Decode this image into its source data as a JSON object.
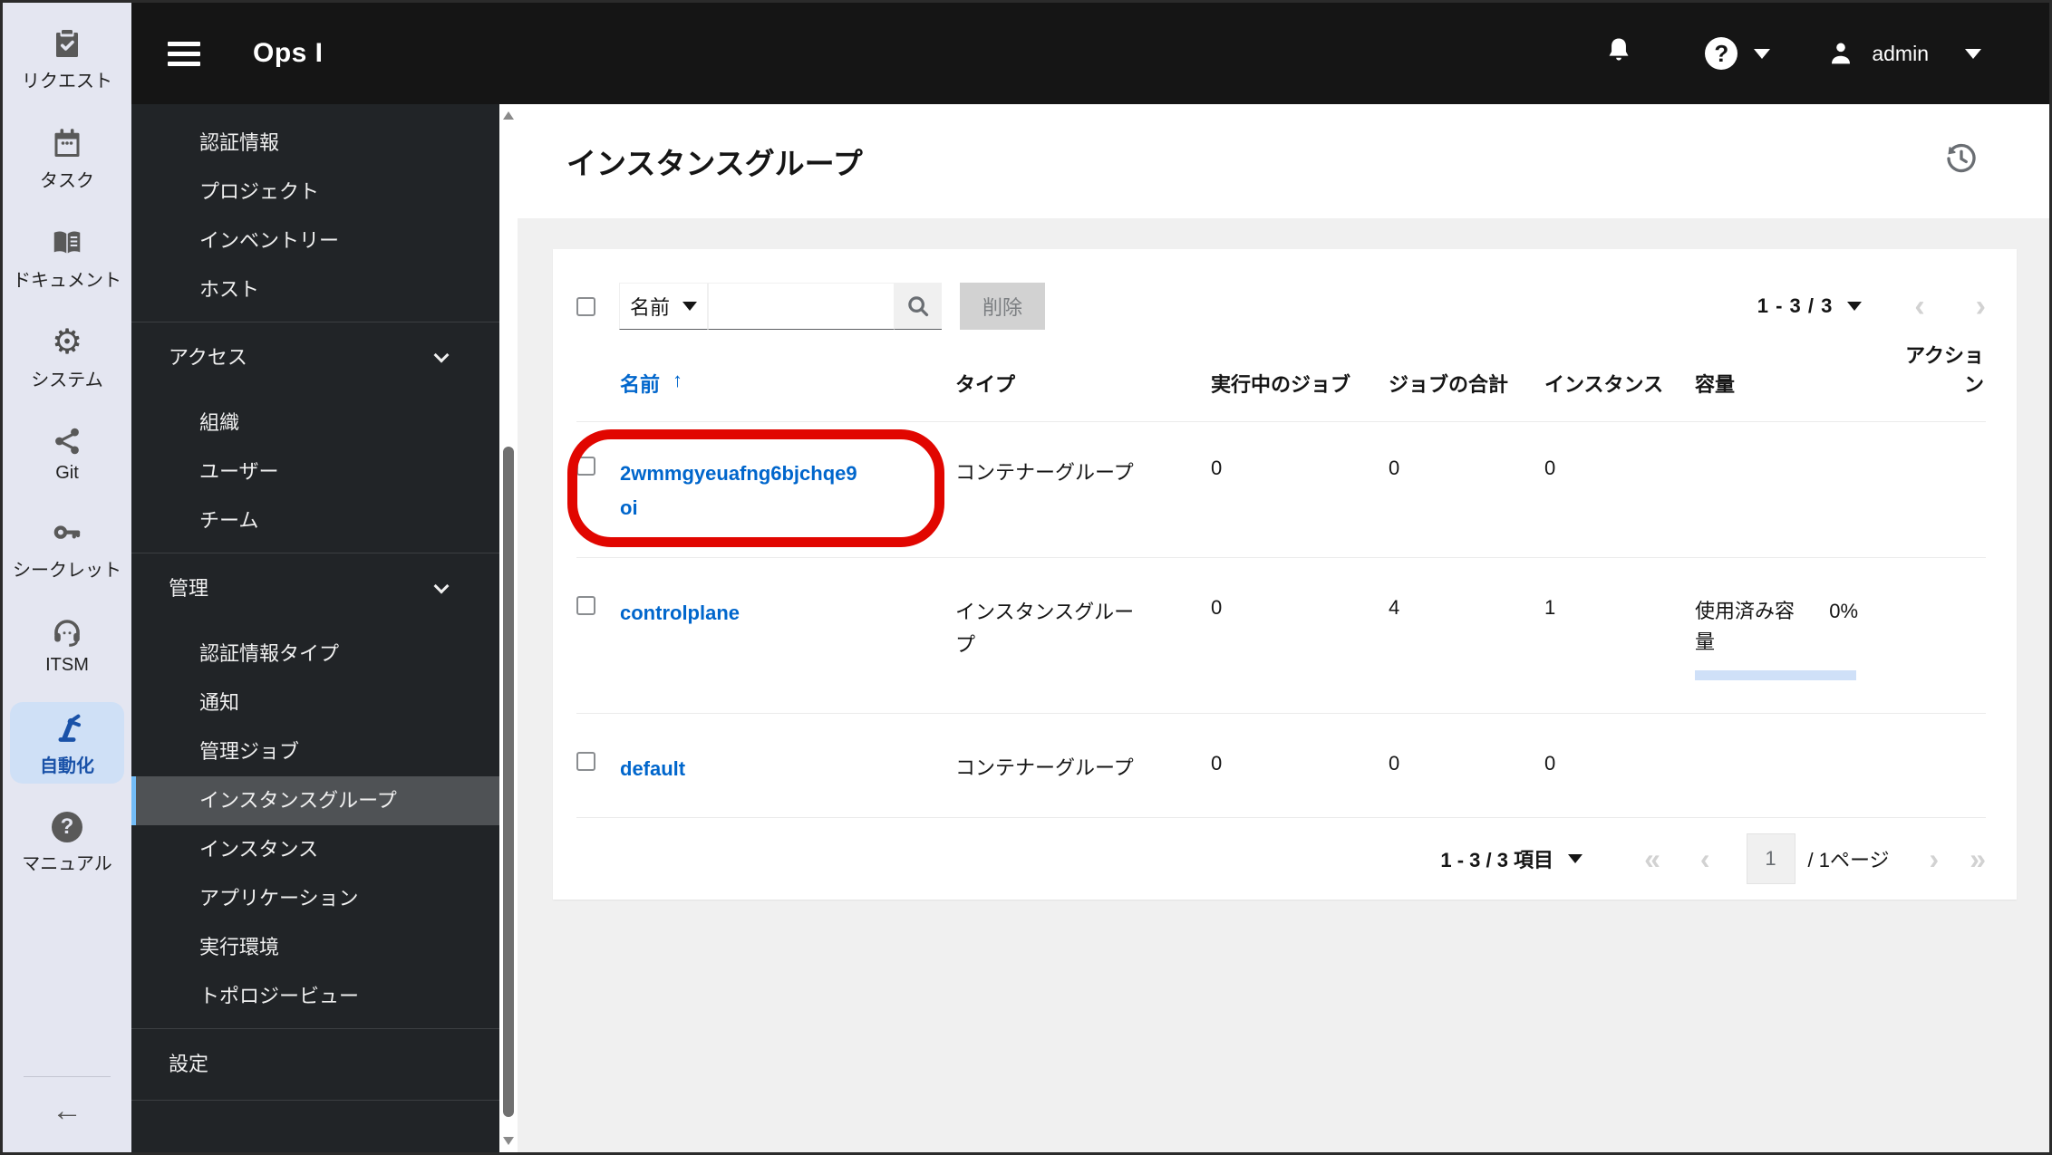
{
  "topbar": {
    "title": "Ops I",
    "user": "admin"
  },
  "rail": {
    "items": [
      {
        "label": "リクエスト",
        "icon": "clipboard-check-icon"
      },
      {
        "label": "タスク",
        "icon": "calendar-icon"
      },
      {
        "label": "ドキュメント",
        "icon": "document-book-icon"
      },
      {
        "label": "システム",
        "icon": "gear-icon"
      },
      {
        "label": "Git",
        "icon": "git-share-icon"
      },
      {
        "label": "シークレット",
        "icon": "key-icon"
      },
      {
        "label": "ITSM",
        "icon": "headset-icon"
      },
      {
        "label": "自動化",
        "icon": "automation-robot-icon"
      },
      {
        "label": "マニュアル",
        "icon": "question-circle-icon"
      }
    ],
    "active_label": "自動化",
    "back_arrow": "←",
    "gear_glyph": "⚙",
    "question_glyph": "?"
  },
  "sidebar": {
    "groups": [
      {
        "items": [
          "認証情報",
          "プロジェクト",
          "インベントリー",
          "ホスト"
        ]
      },
      {
        "title": "アクセス",
        "items": [
          "組織",
          "ユーザー",
          "チーム"
        ]
      },
      {
        "title": "管理",
        "items": [
          "認証情報タイプ",
          "通知",
          "管理ジョブ",
          "インスタンスグループ",
          "インスタンス",
          "アプリケーション",
          "実行環境",
          "トポロジービュー"
        ],
        "active_item": "インスタンスグループ"
      },
      {
        "title": "設定",
        "items": []
      }
    ]
  },
  "main": {
    "title": "インスタンスグループ",
    "toolbar": {
      "filter_label": "名前",
      "search_value": "",
      "delete_label": "削除",
      "pagination_count": "1 - 3 / 3",
      "prev_chevron": "‹",
      "next_chevron": "›"
    },
    "table": {
      "headers": {
        "name": "名前",
        "sort_arrow": "↑",
        "type": "タイプ",
        "running_jobs": "実行中のジョブ",
        "total_jobs": "ジョブの合計",
        "instances": "インスタンス",
        "capacity": "容量",
        "actions": "アクション"
      },
      "rows": [
        {
          "name": "2wmmgyeuafng6bjchqe9oi",
          "type": "コンテナーグループ",
          "running_jobs": "0",
          "total_jobs": "0",
          "instances": "0"
        },
        {
          "name": "controlplane",
          "type": "インスタンスグループ",
          "running_jobs": "0",
          "total_jobs": "4",
          "instances": "1",
          "capacity_label": "使用済み容量",
          "capacity_pct": "0%"
        },
        {
          "name": "default",
          "type": "コンテナーグループ",
          "running_jobs": "0",
          "total_jobs": "0",
          "instances": "0"
        }
      ]
    },
    "bottom_pagination": {
      "summary": "1 - 3 / 3 項目",
      "first_chevron": "«",
      "prev_chevron": "‹",
      "page": "1",
      "of_label": "/ 1ページ",
      "next_chevron": "›",
      "last_chevron": "»"
    },
    "annotation": {
      "shape": "red-oval",
      "around": "2wmmgyeuafng6bjchqe9oi"
    }
  },
  "colors": {
    "topbar_bg": "#151515",
    "sidebar_bg": "#212427",
    "rail_bg": "#e4e6f1",
    "rail_active_bg": "#cfe0f6",
    "link_blue": "#0066cc",
    "selected_nav_bg": "#4f5255",
    "selected_nav_border": "#73bcf7",
    "annotation_red": "#e10600",
    "capacity_bar": "#cfe0f8",
    "page_bg": "#f0f0f0"
  }
}
